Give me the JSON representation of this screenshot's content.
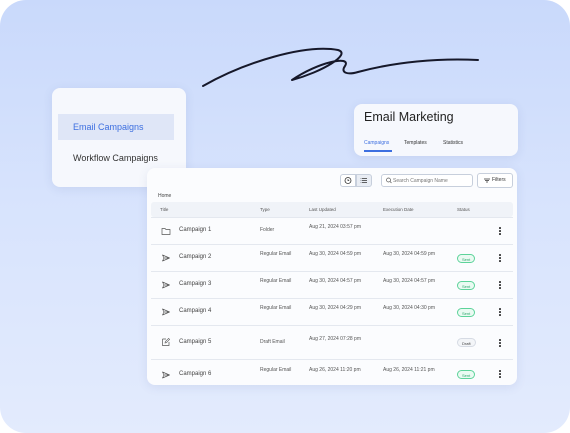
{
  "colors": {
    "accent": "#3d6fe0",
    "sent": "#2ba56c",
    "background": "#d7e3fd"
  },
  "menu": {
    "items": [
      {
        "label": "Email Campaigns",
        "active": true
      },
      {
        "label": "Workflow Campaigns",
        "active": false
      }
    ]
  },
  "header": {
    "title": "Email Marketing",
    "tabs": [
      {
        "label": "Campaigns",
        "active": true
      },
      {
        "label": "Templates",
        "active": false
      },
      {
        "label": "Statistics",
        "active": false
      }
    ]
  },
  "toolbar": {
    "search_placeholder": "Search Campaign Name",
    "filters_label": "Filters",
    "icons": [
      "clock-icon",
      "list-icon",
      "search-icon",
      "filter-icon"
    ]
  },
  "breadcrumb": "Home",
  "table": {
    "columns": [
      "Title",
      "Type",
      "Last Updated",
      "Execution Date",
      "Status"
    ],
    "rows": [
      {
        "icon": "folder-icon",
        "title": "Campaign 1",
        "type": "Folder",
        "updated": "Aug 21, 2024 03:57 pm",
        "execution": "",
        "status": ""
      },
      {
        "icon": "send-icon",
        "title": "Campaign 2",
        "type": "Regular Email",
        "updated": "Aug 30, 2024 04:59 pm",
        "execution": "Aug 30, 2024 04:59 pm",
        "status": "Sent"
      },
      {
        "icon": "send-icon",
        "title": "Campaign 3",
        "type": "Regular Email",
        "updated": "Aug 30, 2024 04:57 pm",
        "execution": "Aug 30, 2024 04:57 pm",
        "status": "Sent"
      },
      {
        "icon": "send-icon",
        "title": "Campaign 4",
        "type": "Regular Email",
        "updated": "Aug 30, 2024 04:29 pm",
        "execution": "Aug 30, 2024 04:30 pm",
        "status": "Sent"
      },
      {
        "icon": "edit-icon",
        "title": "Campaign 5",
        "type": "Draft Email",
        "updated": "Aug 27, 2024 07:28 pm",
        "execution": "",
        "status": "Draft"
      },
      {
        "icon": "send-icon",
        "title": "Campaign 6",
        "type": "Regular Email",
        "updated": "Aug 26, 2024 11:20 pm",
        "execution": "Aug 26, 2024 11:21 pm",
        "status": "Sent"
      }
    ]
  }
}
